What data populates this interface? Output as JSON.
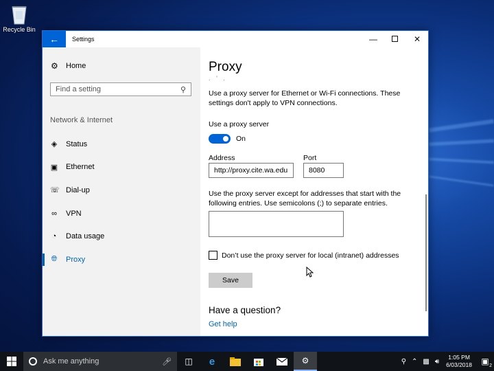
{
  "desktop": {
    "recycle_bin_label": "Recycle Bin"
  },
  "window": {
    "title": "Settings",
    "back_icon": "arrow-left-icon",
    "controls": [
      "minimize",
      "maximize",
      "close"
    ]
  },
  "sidebar": {
    "home_label": "Home",
    "search_placeholder": "Find a setting",
    "section_label": "Network & Internet",
    "items": [
      {
        "label": "Status",
        "icon": "globe-status-icon"
      },
      {
        "label": "Ethernet",
        "icon": "ethernet-icon"
      },
      {
        "label": "Dial-up",
        "icon": "dialup-icon"
      },
      {
        "label": "VPN",
        "icon": "vpn-icon"
      },
      {
        "label": "Data usage",
        "icon": "data-usage-icon"
      },
      {
        "label": "Proxy",
        "icon": "globe-icon",
        "active": true
      }
    ]
  },
  "main": {
    "title": "Proxy",
    "description": "Use a proxy server for Ethernet or Wi-Fi connections. These settings don't apply to VPN connections.",
    "use_proxy_label": "Use a proxy server",
    "toggle_state": "On",
    "address_label": "Address",
    "address_value": "http://proxy.cite.wa.edu",
    "port_label": "Port",
    "port_value": "8080",
    "exceptions_text": "Use the proxy server except for addresses that start with the following entries. Use semicolons (;) to separate entries.",
    "exceptions_value": "",
    "local_checkbox_label": "Don’t use the proxy server for local (intranet) addresses",
    "local_checkbox_checked": false,
    "save_label": "Save",
    "question_heading": "Have a question?",
    "help_link": "Get help"
  },
  "taskbar": {
    "search_placeholder": "Ask me anything",
    "time": "1:05 PM",
    "date": "6/03/2018",
    "notification_count": "2",
    "accent": "#0063d6"
  }
}
